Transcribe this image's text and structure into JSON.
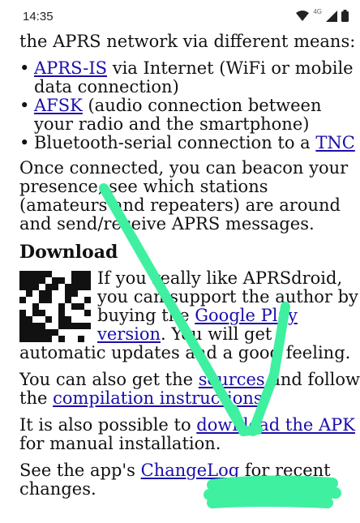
{
  "status": {
    "time": "14:35",
    "network": "4G"
  },
  "intro": {
    "text": "the APRS network via different means:"
  },
  "means": [
    {
      "link": "APRS-IS",
      "rest": " via Internet (WiFi or mobile data connection)"
    },
    {
      "link": "AFSK",
      "rest": " (audio connection between your radio and the smartphone)"
    },
    {
      "pre": "Bluetooth-serial connection to a ",
      "link": "TNC"
    }
  ],
  "connected_text": "Once connected, you can beacon your presence, see which stations (amateurs and repeaters) are around and send/receive APRS messages.",
  "download": {
    "heading": "Download",
    "p1_a": "If you really like APRSdroid, you can support the author by buying the ",
    "p1_link": "Google Play version",
    "p1_b": ". You will get automatic updates and a good feeling.",
    "p2_a": "You can also get the ",
    "p2_link1": "sources",
    "p2_b": " and follow the ",
    "p2_link2": "compilation instructions",
    "p2_c": ".",
    "p3_a": "It is also possible to ",
    "p3_link": "download the APK",
    "p3_b": " for manual installation.",
    "p4_a": "See the app's ",
    "p4_link": "ChangeLog",
    "p4_b": " for recent changes."
  },
  "colors": {
    "annotation": "#3ff0a0",
    "link": "#1a0dab"
  }
}
